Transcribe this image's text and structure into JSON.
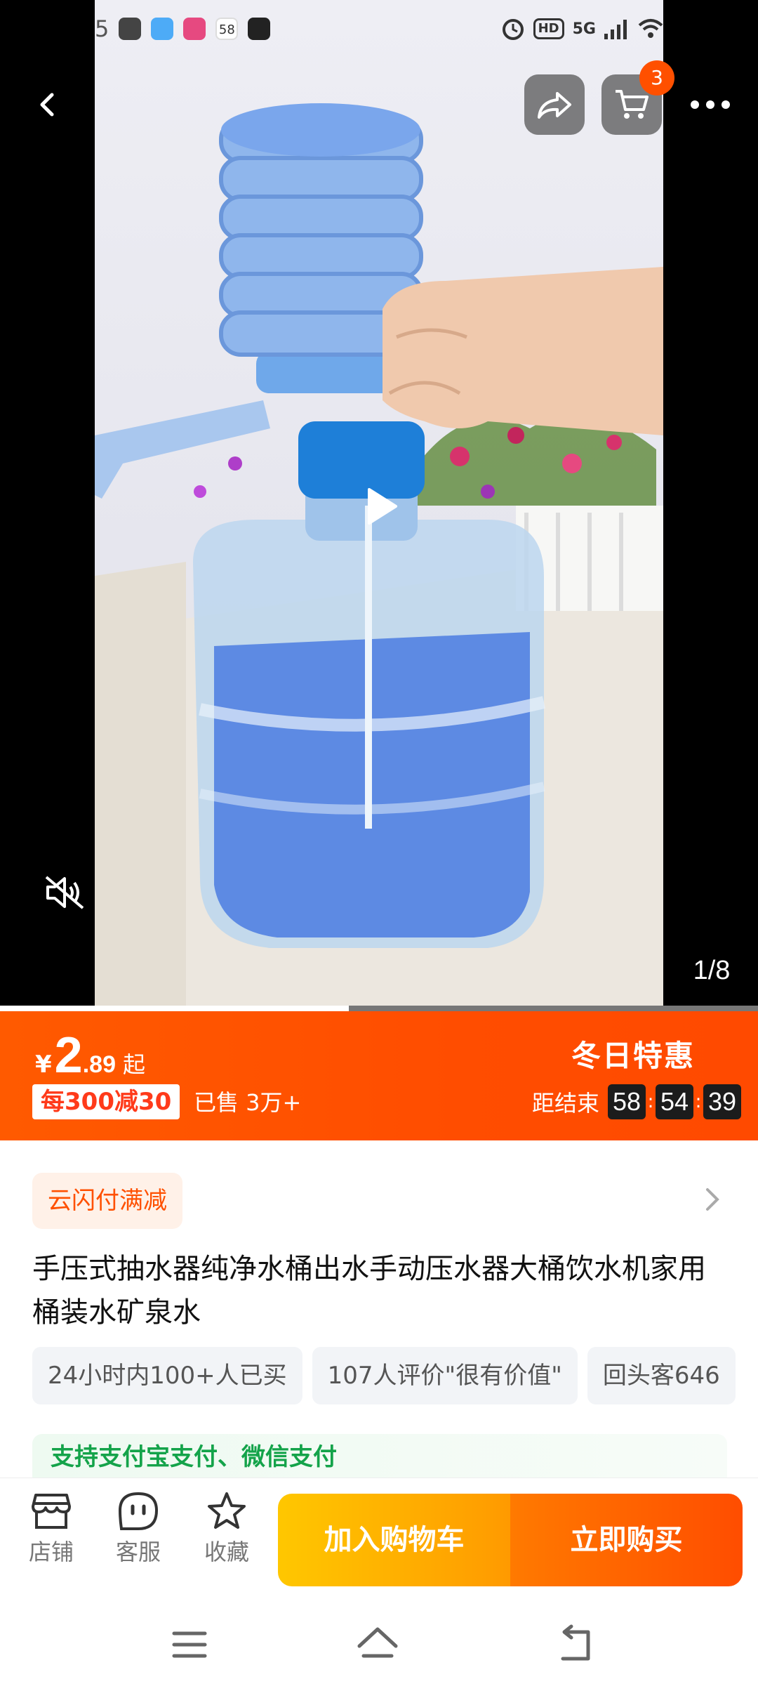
{
  "status_bar": {
    "time_fragment": "5",
    "network_label": "5G",
    "hd_label": "HD",
    "app_badge": "58"
  },
  "media": {
    "cart_count": "3",
    "page_indicator": "1/8",
    "video_progress": 0.46
  },
  "price": {
    "currency": "¥",
    "integer": "2",
    "decimal": ".89",
    "suffix": "起",
    "discount": "每300减30",
    "sold": "已售 3万+",
    "promo_title": "冬日特惠",
    "countdown_label": "距结束",
    "countdown": {
      "h": "58",
      "m": "54",
      "s": "39"
    }
  },
  "info": {
    "coupon": "云闪付满减",
    "title": "手压式抽水器纯净水桶出水手动压水器大桶饮水机家用桶装水矿泉水",
    "tags": [
      "24小时内100+人已买",
      "107人评价\"很有价值\"",
      "回头客646"
    ],
    "payment_note": "支持支付宝支付、微信支付"
  },
  "action_bar": {
    "store": "店铺",
    "service": "客服",
    "favorite": "收藏",
    "add_to_cart": "加入购物车",
    "buy_now": "立即购买"
  },
  "colors": {
    "brand_orange": "#ff5000",
    "cart_yellow": "#ffb300",
    "success_green": "#14a34a"
  },
  "icons": [
    "back-icon",
    "share-icon",
    "cart-icon",
    "more-icon",
    "play-icon",
    "mute-icon",
    "chevron-right-icon",
    "store-icon",
    "service-icon",
    "star-icon",
    "menu-icon",
    "home-icon",
    "back-nav-icon"
  ]
}
